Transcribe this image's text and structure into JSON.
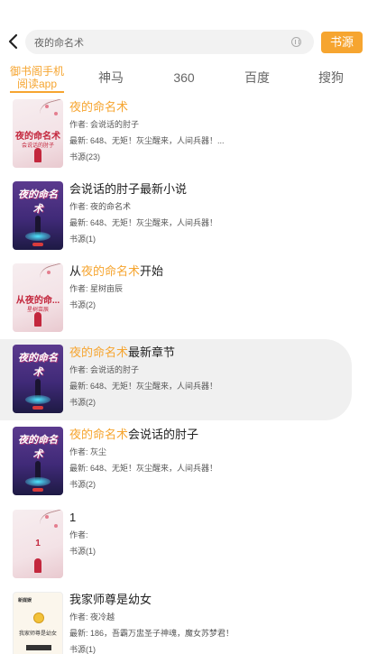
{
  "search": {
    "value": "夜的命名术"
  },
  "source_button": "书源",
  "tabs": [
    {
      "label_line1": "御书阁手机",
      "label_line2": "阅读app"
    },
    {
      "label": "神马"
    },
    {
      "label": "360"
    },
    {
      "label": "百度"
    },
    {
      "label": "搜狗"
    }
  ],
  "books": [
    {
      "title_pre": "",
      "title_hl": "夜的命名术",
      "title_post": "",
      "author": "作者: 会说话的肘子",
      "latest": "最新: 648、无矩！灰尘醒来，人间兵器！...",
      "sources": "书源(23)",
      "cover_title": "夜的命名术",
      "cover_sub": "会说话的肘子"
    },
    {
      "title_pre": "会说话的肘子最新小说",
      "title_hl": "",
      "title_post": "",
      "author": "作者: 夜的命名术",
      "latest": "最新: 648、无矩！灰尘醒来，人间兵器！",
      "sources": "书源(1)",
      "cover_title": "夜的命名术"
    },
    {
      "title_pre": "从",
      "title_hl": "夜的命名术",
      "title_post": "开始",
      "author": "作者: 星树亩辰",
      "latest": "",
      "sources": "书源(2)",
      "cover_title": "从夜的命...",
      "cover_sub": "星树亩辰"
    },
    {
      "title_pre": "",
      "title_hl": "夜的命名术",
      "title_post": "最新章节",
      "author": "作者: 会说话的肘子",
      "latest": "最新: 648、无矩！灰尘醒来，人间兵器！",
      "sources": "书源(2)",
      "cover_title": "夜的命名术"
    },
    {
      "title_pre": "",
      "title_hl": "夜的命名术",
      "title_post": "会说话的肘子",
      "author": "作者: 灰尘",
      "latest": "最新: 648、无矩！灰尘醒来，人间兵器！",
      "sources": "书源(2)",
      "cover_title": "夜的命名术"
    },
    {
      "title_pre": "1",
      "title_hl": "",
      "title_post": "",
      "author": "作者:",
      "latest": "",
      "sources": "书源(1)",
      "cover_title": "1"
    },
    {
      "title_pre": "我家师尊是幼女",
      "title_hl": "",
      "title_post": "",
      "author": "作者: 夜冷越",
      "latest": "最新: 186，吾霸万盅圣子神魂，魔女苏梦君！",
      "sources": "书源(1)",
      "cover_logo": "新媒娱",
      "cover_title": "我家师尊是幼女"
    }
  ],
  "colors": {
    "accent": "#f6a530",
    "highlight_bg": "#f0f0f0"
  },
  "icons": {
    "back": "back-arrow-icon",
    "clear": "clear-icon"
  }
}
